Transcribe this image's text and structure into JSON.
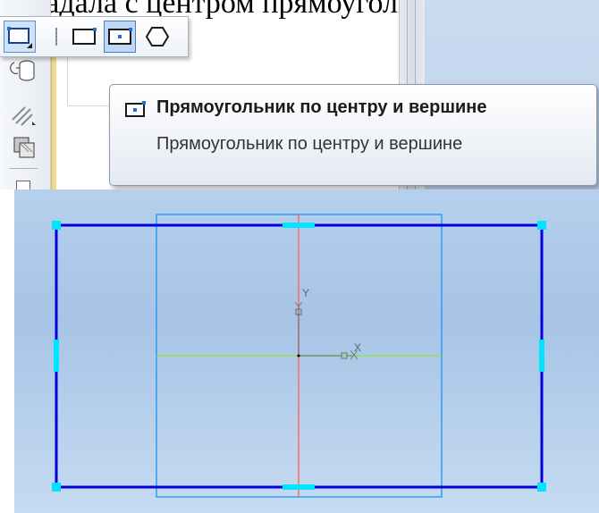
{
  "document": {
    "partial_text": "овпадала с центром прямоугольника"
  },
  "toolbar": {
    "main_tool": "rectangle-icon",
    "flyout_items": [
      "rectangle-icon",
      "rectangle-center-icon",
      "polygon-icon"
    ],
    "side_icons": [
      "cylinder-icon",
      "hatching-icon",
      "fill-icon"
    ]
  },
  "tooltip": {
    "title": "Прямоугольник по центру и вершине",
    "description": "Прямоугольник по центру и вершине"
  },
  "canvas": {
    "axis_y_label": "Y",
    "axis_x_label": "X"
  },
  "colors": {
    "rectangle": "#0000dd",
    "handles": "#00e5ff",
    "guide_box": "#2a9df4",
    "axis_vertical": "#ff6a6a",
    "axis_horizontal": "#8ee24a",
    "canvas_bg": "#b3cdea"
  }
}
